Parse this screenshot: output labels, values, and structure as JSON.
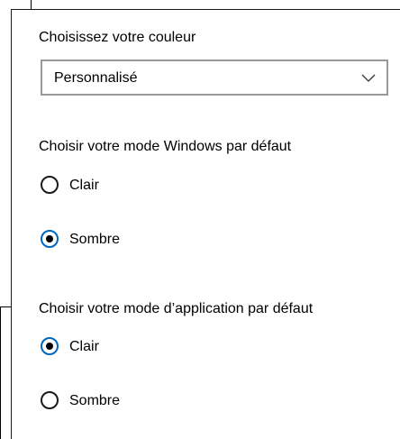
{
  "color_section": {
    "heading": "Choisissez votre couleur",
    "dropdown": {
      "selected": "Personnalisé",
      "icon": "chevron-down-icon"
    }
  },
  "windows_mode": {
    "heading": "Choisir votre mode Windows par défaut",
    "options": [
      {
        "label": "Clair",
        "checked": false
      },
      {
        "label": "Sombre",
        "checked": true
      }
    ]
  },
  "app_mode": {
    "heading": "Choisir votre mode d’application par défaut",
    "options": [
      {
        "label": "Clair",
        "checked": true
      },
      {
        "label": "Sombre",
        "checked": false
      }
    ]
  },
  "colors": {
    "accent": "#0067c0",
    "dropdown_border": "#999999",
    "background": "#ffffff"
  }
}
